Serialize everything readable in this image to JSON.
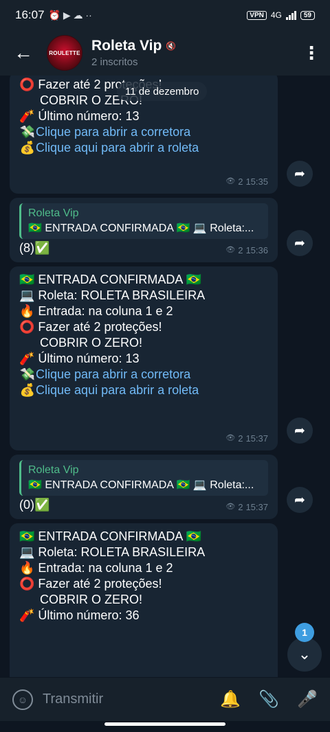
{
  "status_bar": {
    "time": "16:07",
    "vpn": "VPN",
    "network": "4G",
    "battery": "59"
  },
  "header": {
    "title": "Roleta Vip",
    "subtitle": "2 inscritos",
    "avatar_text": "ROULETTE"
  },
  "date_pill": "11 de dezembro",
  "messages": {
    "m1": {
      "line1": "⭕ Fazer até 2 proteções!",
      "line2": "COBRIR O ZERO!",
      "last_number": "🧨 Último número: 13",
      "link1": "Clique para abrir a corretora",
      "link2": "Clique aqui para abrir a roleta",
      "views": "2",
      "time": "15:35"
    },
    "m2": {
      "quote_name": "Roleta Vip",
      "quote_text": "🇧🇷 ENTRADA CONFIRMADA 🇧🇷 💻 Roleta:...",
      "body": "(8)✅",
      "views": "2",
      "time": "15:36"
    },
    "m3": {
      "header": "🇧🇷 ENTRADA CONFIRMADA 🇧🇷",
      "roleta": "💻 Roleta:  ROLETA BRASILEIRA",
      "entrada": "🔥 Entrada: na coluna 1 e 2",
      "protecoes": "⭕ Fazer até 2 proteções!",
      "zero": "COBRIR O ZERO!",
      "last_number": "🧨 Último número: 13",
      "link1": "Clique para abrir a corretora",
      "link2": "Clique aqui para abrir a roleta",
      "views": "2",
      "time": "15:37"
    },
    "m4": {
      "quote_name": "Roleta Vip",
      "quote_text": "🇧🇷 ENTRADA CONFIRMADA 🇧🇷 💻 Roleta:...",
      "body": "(0)✅",
      "views": "2",
      "time": "15:37"
    },
    "m5": {
      "header": "🇧🇷 ENTRADA CONFIRMADA 🇧🇷",
      "roleta": "💻 Roleta:  ROLETA BRASILEIRA",
      "entrada": "🔥 Entrada: na coluna 1 e 2",
      "protecoes": "⭕ Fazer até 2 proteções!",
      "zero": "COBRIR O ZERO!",
      "last_number": "🧨 Último número: 36"
    }
  },
  "unread_count": "1",
  "bottom_bar": {
    "placeholder": "Transmitir"
  },
  "colors": {
    "background": "#0e1621",
    "bubble": "#182533",
    "link": "#71baf7",
    "quote_accent": "#4fbc8a",
    "badge": "#3e9de0"
  }
}
